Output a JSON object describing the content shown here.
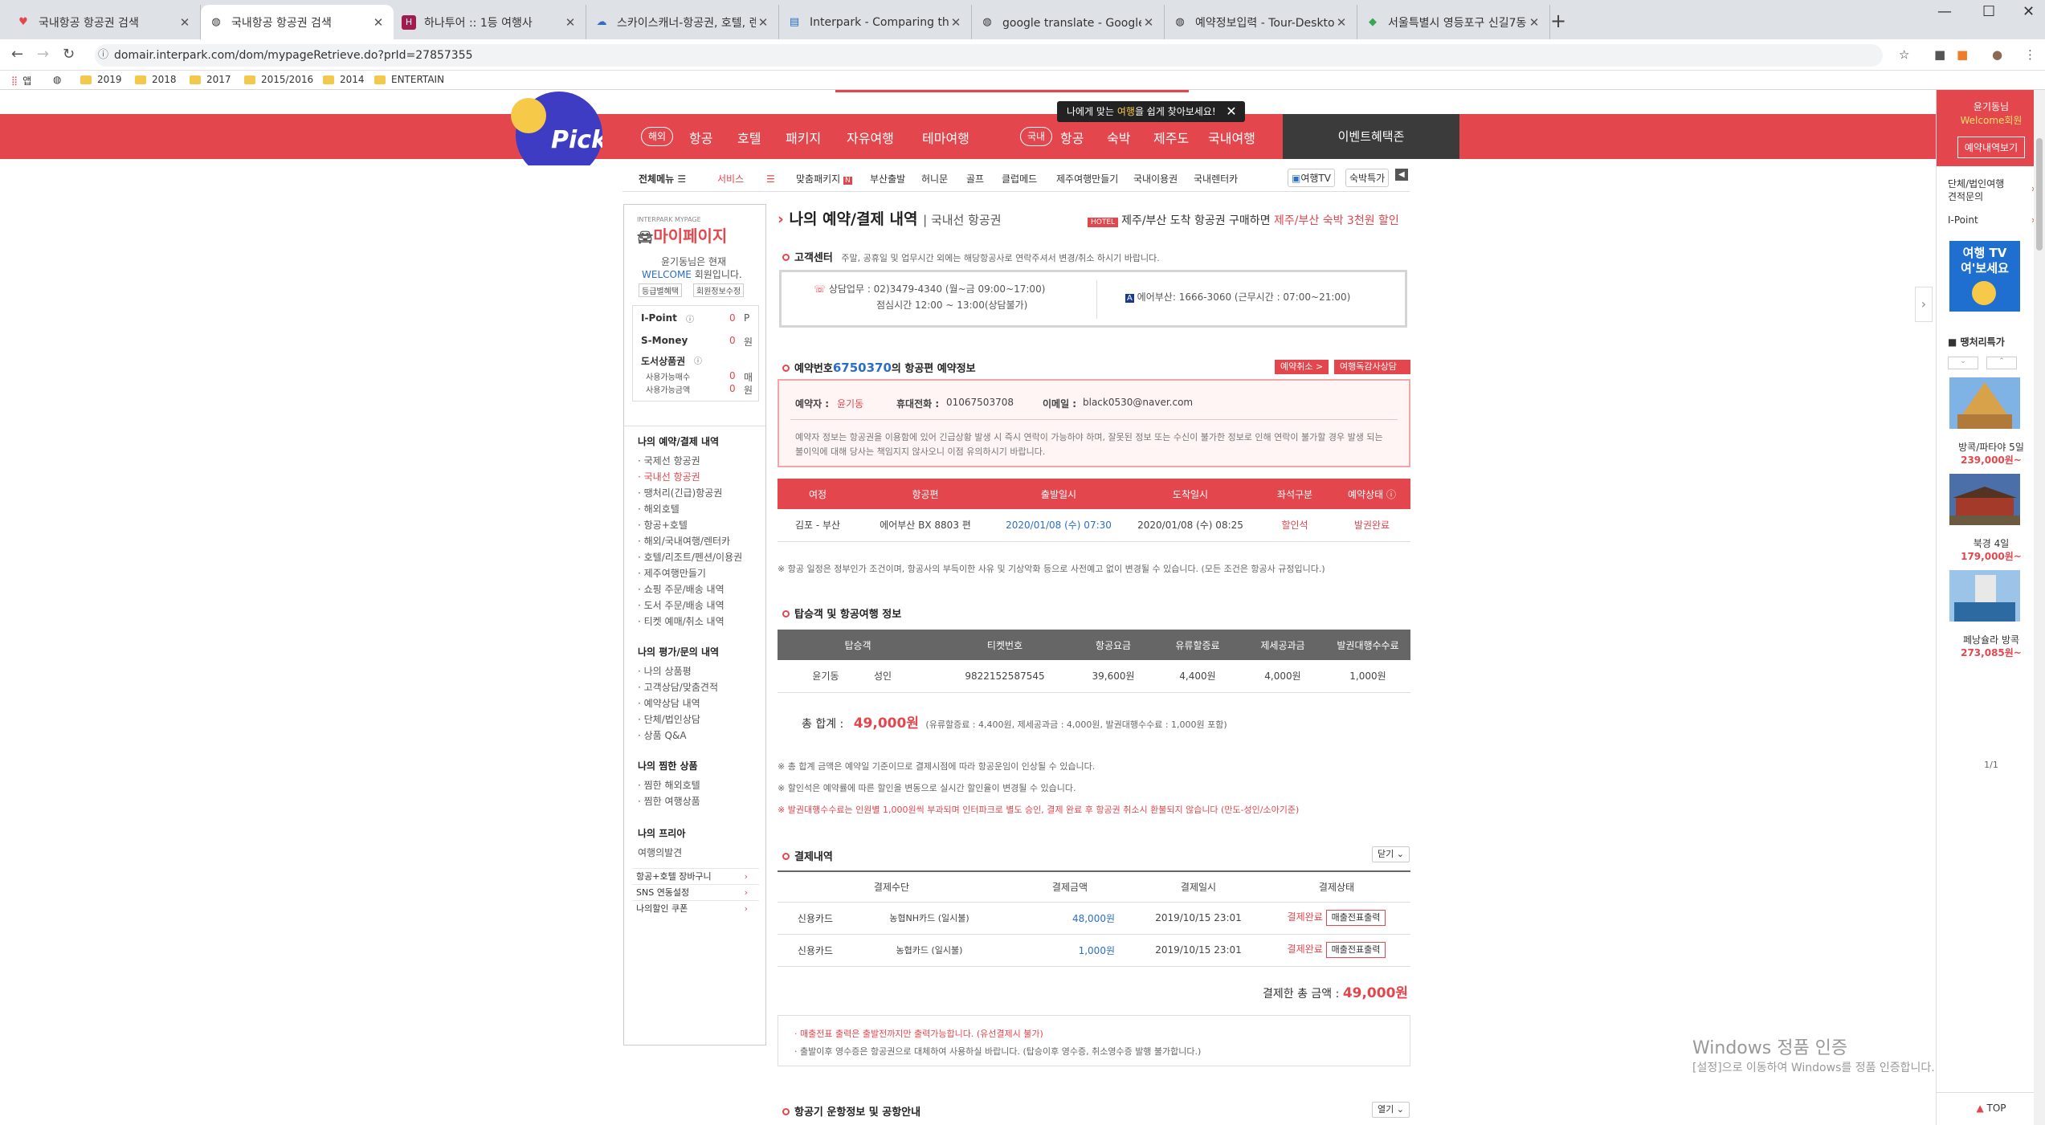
{
  "browser": {
    "tabs": [
      {
        "title": "국내항공 항공권 검색",
        "icon": "heart-icon",
        "color": "#e3474d"
      },
      {
        "title": "국내항공 항공권 검색",
        "icon": "globe-icon",
        "color": "#555555"
      },
      {
        "title": "하나투어 :: 1등 여행사",
        "icon": "hanatour-icon",
        "color": "#a01c4f"
      },
      {
        "title": "스카이스캐너-항공권, 호텔, 렌트",
        "icon": "skyscanner-icon",
        "color": "#2a6ec6"
      },
      {
        "title": "Interpark - Comparing the figu",
        "icon": "doc-icon",
        "color": "#2a6ec6"
      },
      {
        "title": "google translate - Google 검색",
        "icon": "globe-icon",
        "color": "#555555"
      },
      {
        "title": "예약정보입력 - Tour-Desktop",
        "icon": "globe-icon",
        "color": "#555555"
      },
      {
        "title": "서울특별시 영등포구 신길7동 O",
        "icon": "maps-icon",
        "color": "#34a853"
      }
    ],
    "url": "domair.interpark.com/dom/mypageRetrieve.do?prId=27857355",
    "bookmarks": [
      "앱",
      "2019",
      "2018",
      "2017",
      "2015/2016",
      "2014",
      "ENTERTAIN"
    ]
  },
  "gnb": {
    "overseas_pill": "해외",
    "overseas_items": [
      "항공",
      "호텔",
      "패키지",
      "자유여행",
      "테마여행"
    ],
    "domestic_pill": "국내",
    "domestic_items": [
      "항공",
      "숙박",
      "제주도",
      "국내여행"
    ],
    "event": "이벤트혜택존",
    "toast_pre": "나에게 맞는 ",
    "toast_hl": "여행",
    "toast_post": "을 쉽게 찾아보세요!",
    "pick": "Pick"
  },
  "submenu": {
    "all_menu": "전체메뉴",
    "service": "서비스",
    "items": [
      "맞춤패키지",
      "부산출발",
      "허니문",
      "골프",
      "클럽메드",
      "제주여행만들기",
      "국내이용권",
      "국내렌터카"
    ],
    "travel_tv": "여행TV",
    "lodging_special": "숙박특가"
  },
  "lnb": {
    "logo_small": "INTERPARK MYPAGE",
    "logo": "마이페이지",
    "greeting": "윤기동님은 현재",
    "grade_pre": "WELCOME",
    "grade_post": " 회원입니다.",
    "btn_grade": "등급별혜택",
    "btn_info": "회원정보수정",
    "ipoint_label": "I-Point",
    "ipoint_val": "0",
    "ipoint_unit": "P",
    "smoney_label": "S-Money",
    "smoney_val": "0",
    "smoney_unit": "원",
    "book_label": "도서상품권",
    "book_count_label": "사용가능매수",
    "book_count_val": "0",
    "book_count_unit": "매",
    "book_amt_label": "사용가능금액",
    "book_amt_val": "0",
    "book_amt_unit": "원",
    "sec1_title": "나의 예약/결제 내역",
    "sec1_items": [
      "국제선 항공권",
      "국내선 항공권",
      "땡처리(긴급)항공권",
      "해외호텔",
      "항공+호텔",
      "해외/국내여행/렌터카",
      "호텔/리조트/펜션/이용권",
      "제주여행만들기",
      "쇼핑 주문/배송 내역",
      "도서 주문/배송 내역",
      "티켓 예매/취소 내역"
    ],
    "sec2_title": "나의 평가/문의 내역",
    "sec2_items": [
      "나의 상품평",
      "고객상담/맞춤견적",
      "예약상담 내역",
      "단체/법인상담",
      "상품 Q&A"
    ],
    "sec3_title": "나의 찜한 상품",
    "sec3_items": [
      "찜한 해외호텔",
      "찜한 여행상품"
    ],
    "sec4_title": "나의 프리아",
    "sec4_items": [
      "여행의발견"
    ],
    "links": [
      "항공+호텔 장바구니",
      "SNS 연동설정",
      "나의할인 쿠폰"
    ]
  },
  "main": {
    "title": "나의 예약/결제 내역",
    "subtitle": "국내선 항공권",
    "promo_badge": "HOTEL",
    "promo_pre": "제주/부산 도착 항공권 구매하면 ",
    "promo_hl": "제주/부산 숙박 3천원 할인",
    "cs_title": "고객센터",
    "cs_desc": "주말, 공휴일 및 업무시간 외에는 해당항공사로 연락주셔서 변경/취소 하시기 바랍니다.",
    "cs_phone": "상담업무 : 02)3479-4340 (월~금 09:00~17:00)",
    "cs_lunch": "점심시간 12:00 ~ 13:00(상담불가)",
    "cs_airline": "에어부산: 1666-3060 (근무시간 : 07:00~21:00)",
    "res_pre": "예약번호",
    "res_no": "6750370",
    "res_post": "의 항공편 예약정보",
    "btn_cancel": "예약취소 >",
    "btn_consult": "여행독감사상담 >",
    "booker_label": "예약자 :",
    "booker": "윤기동",
    "mobile_label": "휴대전화 :",
    "mobile": "01067503708",
    "email_label": "이메일 :",
    "email": "black0530@naver.com",
    "booker_notice": "예약자 정보는 항공권을 이용함에 있어 긴급상황 발생 시 즉시 연락이 가능하야 하며, 잘못된 정보 또는 수신이 불가한 정보로 인해 연락이 불가할 경우 발생 되는 불이익에 대해 당사는 책임지지 않사오니 이점 유의하시기 바랍니다.",
    "flight_headers": [
      "여정",
      "항공편",
      "출발일시",
      "도착일시",
      "좌석구분",
      "예약상태"
    ],
    "flight_row": [
      "김포 - 부산",
      "에어부산 BX 8803 편",
      "2020/01/08 (수) 07:30",
      "2020/01/08 (수) 08:25",
      "할인석",
      "발권완료"
    ],
    "flight_note": "※ 항공 일정은 정부인가 조건이며, 항공사의 부득이한 사유 및 기상악화 등으로 사전예고 없이 변경될 수 있습니다. (모든 조건은 항공사 규정입니다.)",
    "pax_title": "탑승객 및 항공여행 정보",
    "pax_headers": [
      "탑승객",
      "티켓번호",
      "항공요금",
      "유류할증료",
      "제세공과금",
      "발권대행수수료"
    ],
    "pax_row": [
      "윤기동",
      "성인",
      "9822152587545",
      "39,600원",
      "4,400원",
      "4,000원",
      "1,000원"
    ],
    "total_label": "총 합계 :",
    "total": "49,000원",
    "total_detail": "(유류할증료 : 4,400원, 제세공과금 : 4,000원, 발권대행수수료 : 1,000원 포함)",
    "notes": [
      "※ 총 합계 금액은 예약일 기준이므로 결제시점에 따라 항공운임이 인상될 수 있습니다.",
      "※ 할인석은 예약률에 따른 할인을 변동으로 실시간 할인율이 변경될 수 있습니다.",
      "※ 발권대행수수료는 인원별 1,000원씩 부과되며 인터파크로 별도 승인, 결제 완료 후 항공권 취소시 환불되지 않습니다 (만도-성인/소아기준)"
    ],
    "pay_title": "결제내역",
    "pay_toggle": "닫기",
    "pay_headers": [
      "결제수단",
      "결제금액",
      "결제일시",
      "결제상태"
    ],
    "pay_rows": [
      [
        "신용카드",
        "농협NH카드 (일시불)",
        "48,000원",
        "2019/10/15 23:01",
        "결제완료",
        "매출전표출력"
      ],
      [
        "신용카드",
        "농협카드 (일시불)",
        "1,000원",
        "2019/10/15 23:01",
        "결제완료",
        "매출전표출력"
      ]
    ],
    "pay_total_label": "결제한 총 금액 :",
    "pay_total": "49,000원",
    "receipt_notes": [
      "매출전표 출력은 출발전까지만 출력가능합니다. (유선결제시 불가)",
      "출발이후 영수증은 항공권으로 대체하여 사용하실 바랍니다. (탑승이후 영수증, 취소영수증 발행 불가합니다.)"
    ],
    "ops_title": "항공기 운항정보 및 공항안내",
    "ops_toggle": "열기"
  },
  "rsb": {
    "greet": "윤기동님",
    "grade": "Welcome회원",
    "btn": "예약내역보기",
    "group": "단체/법인여행",
    "quote": "견적문의",
    "ipoint": "I-Point",
    "tv": "여행 TV 여'보세요",
    "deal_title": "땡처리특가",
    "products": [
      {
        "title": "방콕/파타야 5일",
        "price": "239,000원~"
      },
      {
        "title": "북경 4일",
        "price": "179,000원~"
      },
      {
        "title": "페낭슐라 방콕",
        "price": "273,085원~"
      }
    ],
    "pager": "1/1",
    "top": "TOP"
  },
  "watermark": {
    "line1": "Windows 정품 인증",
    "line2": "[설정]으로 이동하여 Windows를 정품 인증합니다."
  }
}
